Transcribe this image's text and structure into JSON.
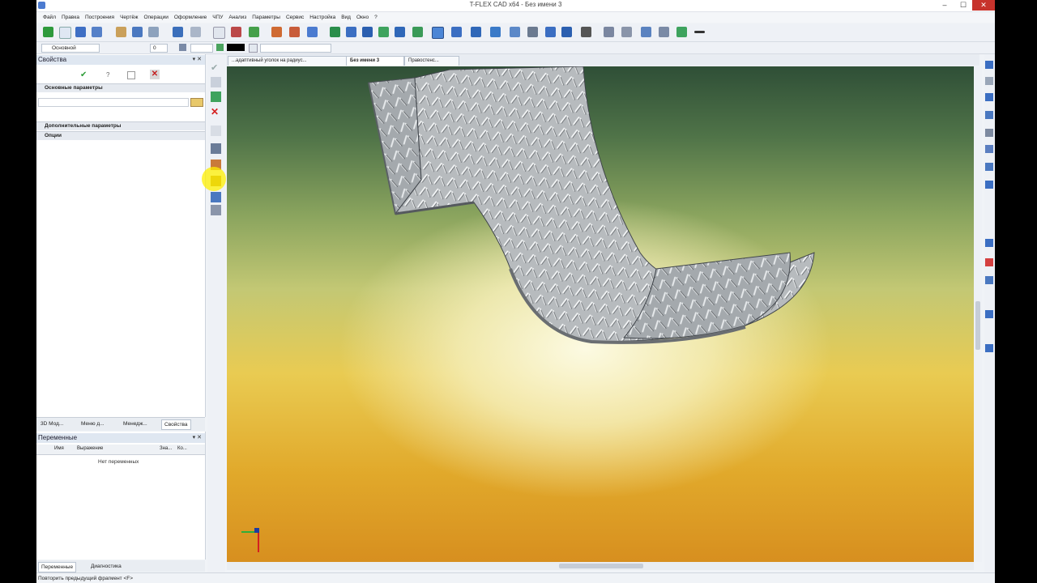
{
  "window": {
    "title": "T-FLEX CAD x64 - Без имени 3",
    "minimize": "–",
    "maximize": "☐",
    "close": "✕"
  },
  "menu": [
    "Файл",
    "Правка",
    "Построения",
    "Чертёж",
    "Операции",
    "Оформление",
    "ЧПУ",
    "Анализ",
    "Параметры",
    "Сервис",
    "Настройка",
    "Вид",
    "Окно",
    "?"
  ],
  "toolbar2": {
    "layer": "Основной",
    "number": "0"
  },
  "properties_panel": {
    "title": "Свойства",
    "sections": [
      "Основные параметры",
      "Дополнительные параметры",
      "Опции"
    ],
    "ok_icon": "check-icon",
    "cancel_icon": "x-icon"
  },
  "panel_tabs": [
    "3D Мод...",
    "Меню д...",
    "Менедж...",
    "Свойства"
  ],
  "variables_panel": {
    "title": "Переменные",
    "columns": [
      "Имя",
      "Выражение",
      "Зна...",
      "Ко..."
    ],
    "empty_text": "Нет переменных"
  },
  "bottom_tabs": [
    "Переменные",
    "Диагностика"
  ],
  "status": "Повторить предыдущий фрагмент <F>",
  "doc_tabs": [
    "...адаптивный уголок на радиус...",
    "Без имени 3",
    "Правостенс..."
  ],
  "colors": {
    "close_button": "#c7332c",
    "highlight": "#ffef00",
    "axis_x": "#2fae3a",
    "axis_y": "#d42020"
  }
}
